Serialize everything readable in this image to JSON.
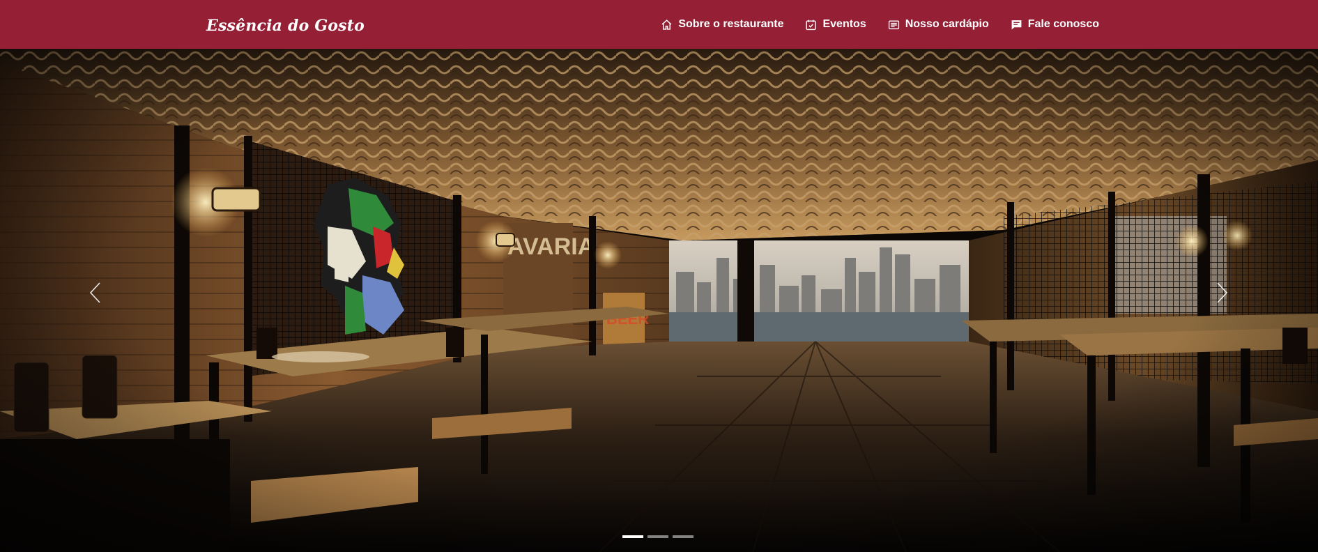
{
  "brand": {
    "name": "Essência do Gosto"
  },
  "nav": {
    "items": [
      {
        "label": "Sobre o restaurante",
        "icon": "home-icon"
      },
      {
        "label": "Eventos",
        "icon": "calendar-check-icon"
      },
      {
        "label": "Nosso cardápio",
        "icon": "menu-list-icon"
      },
      {
        "label": "Fale conosco",
        "icon": "chat-icon"
      }
    ]
  },
  "carousel": {
    "slides": [
      "restaurant-interior"
    ],
    "active_index": 0,
    "indicator_count": 3,
    "prev_icon": "chevron-left-icon",
    "next_icon": "chevron-right-icon"
  },
  "colors": {
    "navbar_bg": "#951f35",
    "nav_text": "#ffffff",
    "indicator_active": "#ffffff",
    "indicator_inactive": "rgba(255,255,255,0.5)"
  }
}
